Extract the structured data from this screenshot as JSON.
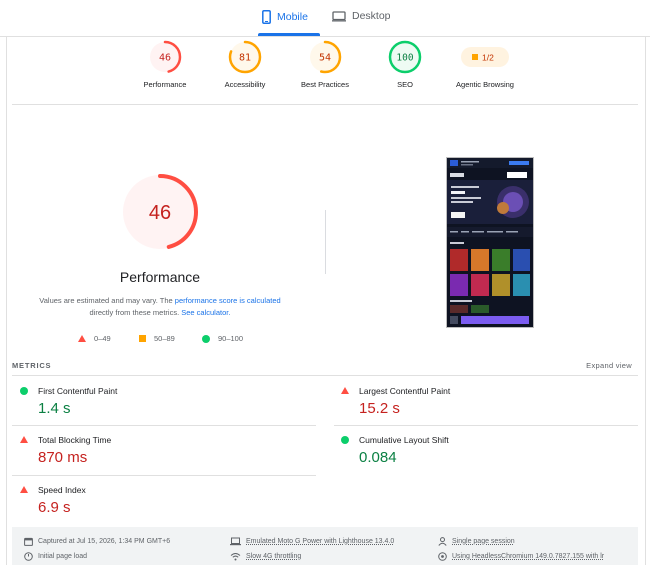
{
  "tabs": {
    "mobile": "Mobile",
    "desktop": "Desktop"
  },
  "categories": [
    {
      "label": "Performance",
      "score": "46",
      "fraction": 0.46,
      "rating": "fail"
    },
    {
      "label": "Accessibility",
      "score": "81",
      "fraction": 0.81,
      "rating": "average"
    },
    {
      "label": "Best Practices",
      "score": "54",
      "fraction": 0.54,
      "rating": "average"
    },
    {
      "label": "SEO",
      "score": "100",
      "fraction": 1.0,
      "rating": "pass"
    },
    {
      "label": "Agentic Browsing",
      "score": "1/2",
      "rating": "average"
    }
  ],
  "main": {
    "score": "46",
    "score_fraction": 0.46,
    "title": "Performance",
    "desc_1": "Values are estimated and may vary. The",
    "desc_link_1": "performance score is calculated",
    "desc_2": "directly from these metrics.",
    "desc_link_2": "See calculator."
  },
  "legend": {
    "fail": "0–49",
    "average": "50–89",
    "pass": "90–100"
  },
  "metrics": {
    "title": "METRICS",
    "expand": "Expand view",
    "fcp": {
      "name": "First Contentful Paint",
      "value": "1.4 s",
      "rating": "pass"
    },
    "lcp": {
      "name": "Largest Contentful Paint",
      "value": "15.2 s",
      "rating": "fail"
    },
    "tbt": {
      "name": "Total Blocking Time",
      "value": "870 ms",
      "rating": "fail"
    },
    "cls": {
      "name": "Cumulative Layout Shift",
      "value": "0.084",
      "rating": "pass"
    },
    "si": {
      "name": "Speed Index",
      "value": "6.9 s",
      "rating": "fail"
    }
  },
  "footer": {
    "captured": "Captured at Jul 15, 2026, 1:34 PM GMT+6",
    "initial": "Initial page load",
    "device": "Emulated Moto G Power with Lighthouse 13.4.0",
    "throttling": "Slow 4G throttling",
    "session": "Single page session",
    "ua": "Using HeadlessChromium 149.0.7827.155 with lr"
  },
  "colors": {
    "fail": "#ff4e42",
    "average": "#ffa400",
    "pass": "#0cce6b",
    "accent": "#1a73e8"
  }
}
